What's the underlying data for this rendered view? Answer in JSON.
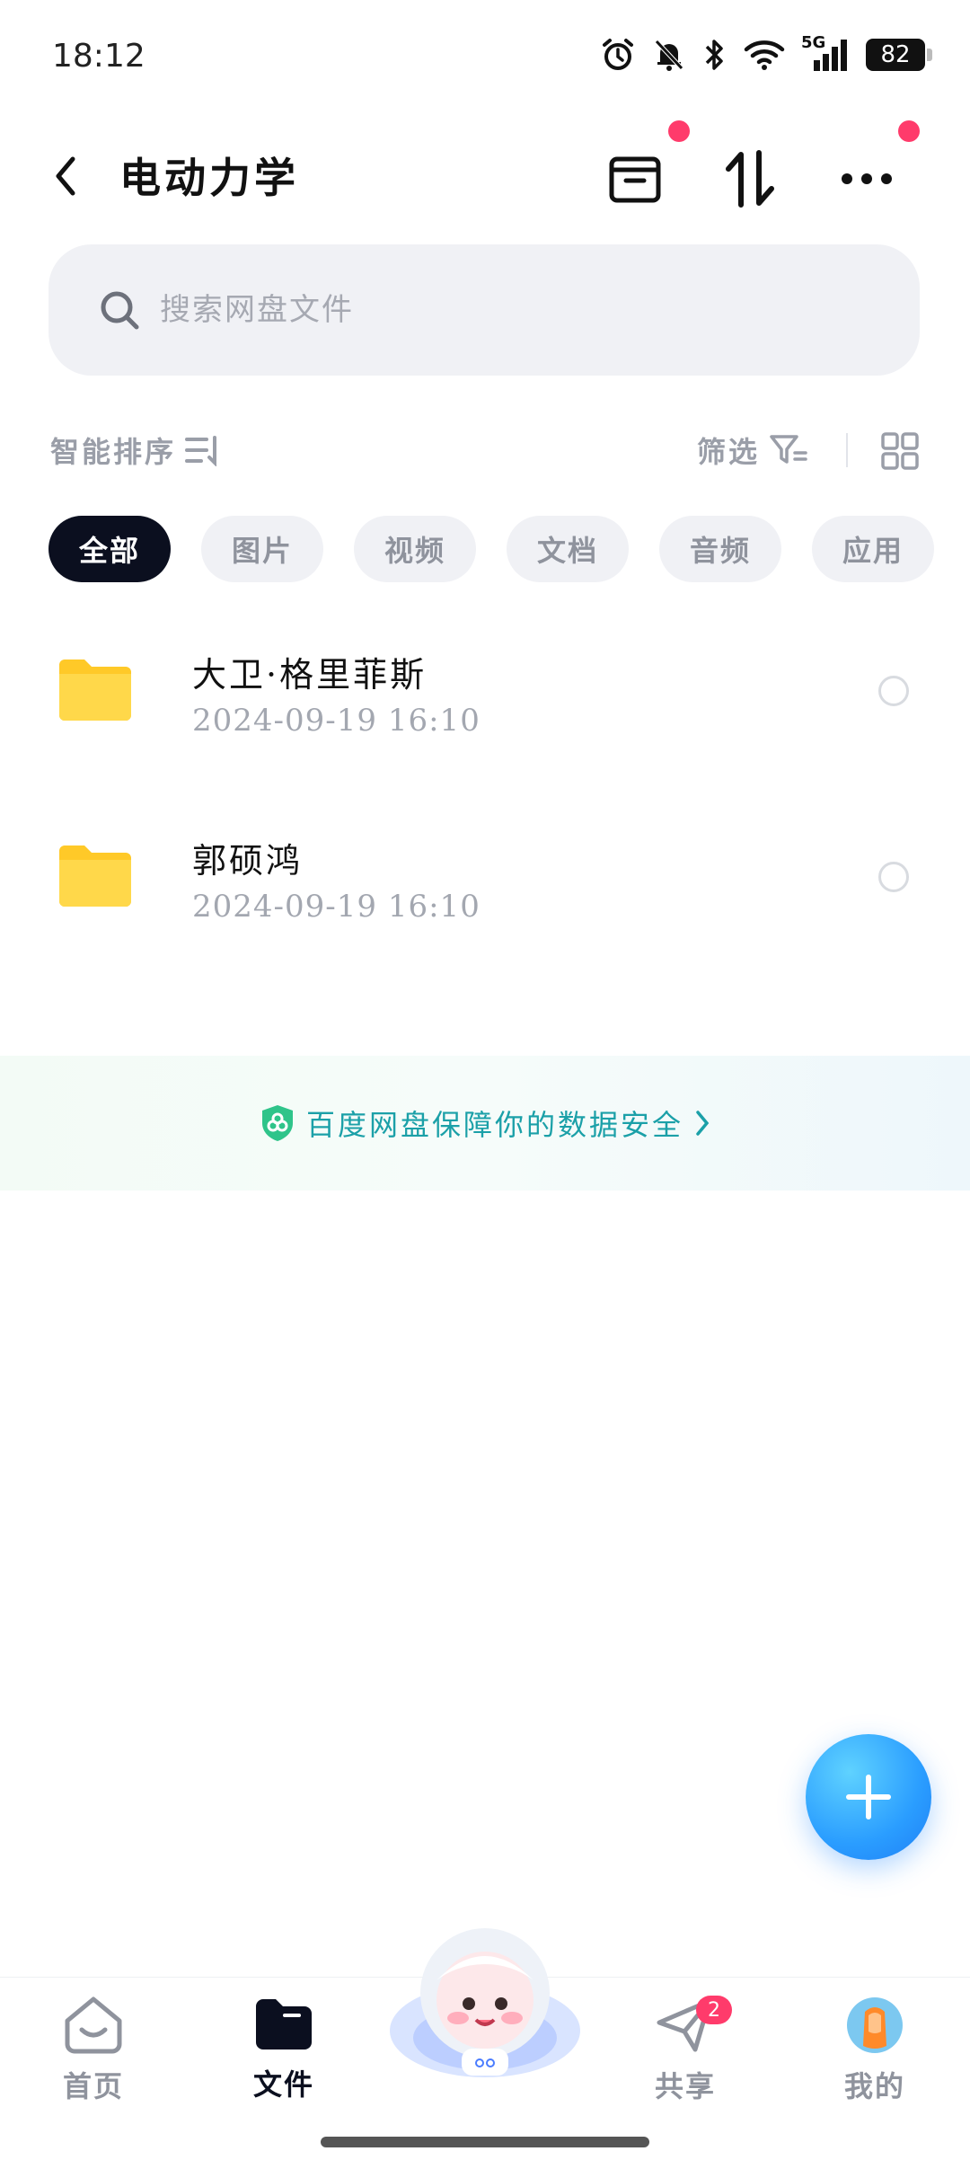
{
  "status_bar": {
    "time": "18:12",
    "network": "5G",
    "battery": "82"
  },
  "header": {
    "title": "电动力学"
  },
  "search": {
    "placeholder": "搜索网盘文件"
  },
  "sort_bar": {
    "sort_label": "智能排序",
    "filter_label": "筛选"
  },
  "tabs": [
    {
      "label": "全部",
      "active": true
    },
    {
      "label": "图片",
      "active": false
    },
    {
      "label": "视频",
      "active": false
    },
    {
      "label": "文档",
      "active": false
    },
    {
      "label": "音频",
      "active": false
    },
    {
      "label": "应用",
      "active": false
    }
  ],
  "files": [
    {
      "name": "大卫·格里菲斯",
      "date": "2024-09-19  16:10"
    },
    {
      "name": "郭硕鸿",
      "date": "2024-09-19  16:10"
    }
  ],
  "banner": {
    "text": "百度网盘保障你的数据安全"
  },
  "bottom_nav": {
    "items": [
      {
        "label": "首页"
      },
      {
        "label": "文件"
      },
      {
        "label": "共享",
        "badge": "2"
      },
      {
        "label": "我的"
      }
    ]
  },
  "colors": {
    "accent": "#2a9dff",
    "active_tab": "#0b0f1f",
    "badge": "#ff3b6b",
    "banner_text": "#1ba0a8",
    "folder": "#ffc928"
  }
}
